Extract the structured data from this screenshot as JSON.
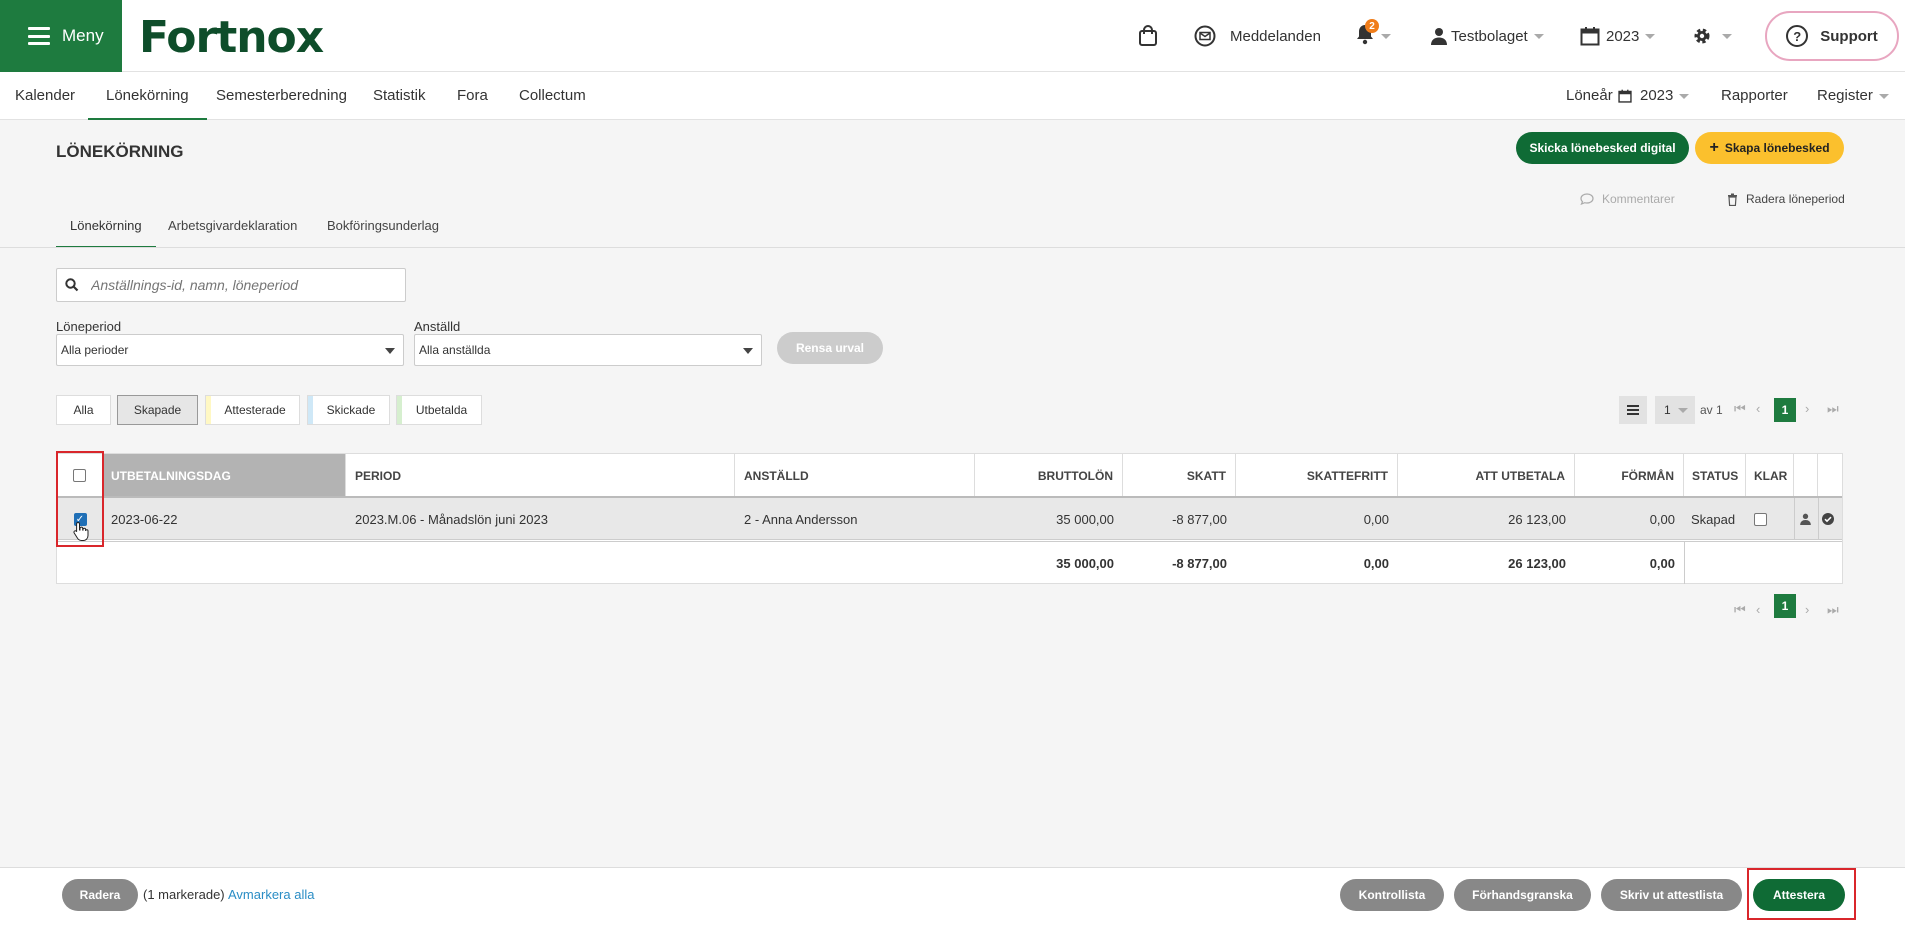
{
  "topbar": {
    "menu_label": "Meny",
    "logo_text": "Fortnox",
    "messages_label": "Meddelanden",
    "notification_count": "2",
    "company_label": "Testbolaget",
    "year_label": "2023",
    "support_label": "Support"
  },
  "nav": {
    "items": [
      "Kalender",
      "Lönekörning",
      "Semesterberedning",
      "Statistik",
      "Fora",
      "Collectum"
    ],
    "active_index": 1,
    "salary_year_label": "Löneår",
    "salary_year_value": "2023",
    "reports_label": "Rapporter",
    "register_label": "Register"
  },
  "page": {
    "title": "LÖNEKÖRNING",
    "send_digital_label": "Skicka lönebesked digital",
    "create_payslip_label": "Skapa lönebesked",
    "comments_label": "Kommentarer",
    "delete_period_label": "Radera löneperiod",
    "tabs": [
      "Lönekörning",
      "Arbetsgivardeklaration",
      "Bokföringsunderlag"
    ],
    "search_placeholder": "Anställnings-id, namn, löneperiod",
    "period_label": "Löneperiod",
    "period_value": "Alla perioder",
    "employee_label": "Anställd",
    "employee_value": "Alla anställda",
    "clear_label": "Rensa urval",
    "filters": [
      "Alla",
      "Skapade",
      "Attesterade",
      "Skickade",
      "Utbetalda"
    ],
    "filter_colors": [
      "#ffffff",
      "#e6e6e6",
      "#fff8c4",
      "#cfe8f7",
      "#d6efcf"
    ],
    "pager_page": "1",
    "pager_of": "av 1",
    "pager_current": "1"
  },
  "table": {
    "headers": [
      "UTBETALNINGSDAG",
      "PERIOD",
      "ANSTÄLLD",
      "BRUTTOLÖN",
      "SKATT",
      "SKATTEFRITT",
      "ATT UTBETALA",
      "FÖRMÅN",
      "STATUS",
      "KLAR"
    ],
    "rows": [
      {
        "date": "2023-06-22",
        "period": "2023.M.06 - Månadslön juni 2023",
        "employee": "2 - Anna Andersson",
        "gross": "35 000,00",
        "tax": "-8 877,00",
        "taxfree": "0,00",
        "pay": "26 123,00",
        "benefit": "0,00",
        "status": "Skapad"
      }
    ],
    "totals": {
      "gross": "35 000,00",
      "tax": "-8 877,00",
      "taxfree": "0,00",
      "pay": "26 123,00",
      "benefit": "0,00"
    }
  },
  "bottom": {
    "delete_label": "Radera",
    "selected_text": "(1 markerade)",
    "deselect_label": "Avmarkera alla",
    "checklist_label": "Kontrollista",
    "preview_label": "Förhandsgranska",
    "print_label": "Skriv ut attestlista",
    "attest_label": "Attestera"
  },
  "colors": {
    "brand_green": "#1e7b3f",
    "yellow": "#fbc02d",
    "highlight_red": "#d9262b"
  }
}
